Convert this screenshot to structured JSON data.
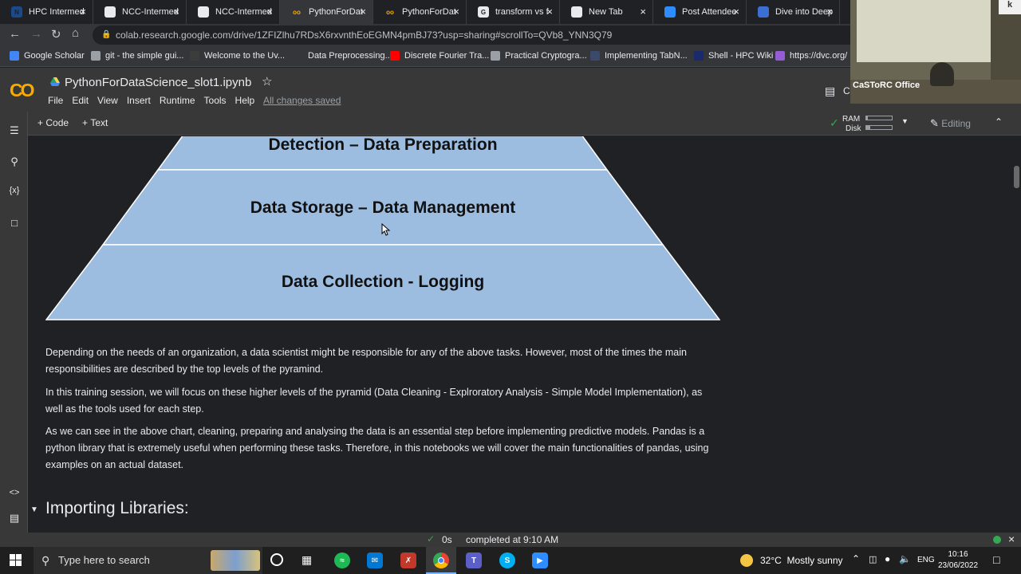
{
  "tabs": [
    {
      "title": "HPC Intermed",
      "color": "#1a4a8a",
      "glyph": "N"
    },
    {
      "title": "NCC-Intermed",
      "color": "#e8eaed",
      "glyph": ""
    },
    {
      "title": "NCC-Intermed",
      "color": "#e8eaed",
      "glyph": ""
    },
    {
      "title": "PythonForDat",
      "color": "#f9ab00",
      "glyph": "co",
      "active": true
    },
    {
      "title": "PythonForDat",
      "color": "#f9ab00",
      "glyph": "co"
    },
    {
      "title": "transform vs f",
      "color": "#e8eaed",
      "glyph": "G"
    },
    {
      "title": "New Tab",
      "color": "#e8eaed",
      "glyph": ""
    },
    {
      "title": "Post Attendee",
      "color": "#2d8cff",
      "glyph": ""
    },
    {
      "title": "Dive into Deep",
      "color": "#3b6fd4",
      "glyph": ""
    }
  ],
  "address": {
    "url": "colab.research.google.com/drive/1ZFIZlhu7RDsX6rxvnthEoEGMN4pmBJ73?usp=sharing#scrollTo=QVb8_YNN3Q79"
  },
  "bookmarks": [
    {
      "label": "Google Scholar",
      "color": "#4285f4"
    },
    {
      "label": "git - the simple gui...",
      "color": "#9aa0a6"
    },
    {
      "label": "Welcome to the Uv...",
      "color": "#3c3c3c"
    },
    {
      "label": "Data Preprocessing...",
      "color": "#35363a"
    },
    {
      "label": "Discrete Fourier Tra...",
      "color": "#ff0000"
    },
    {
      "label": "Practical Cryptogra...",
      "color": "#9aa0a6"
    },
    {
      "label": "Implementing TabN...",
      "color": "#3b4a6b"
    },
    {
      "label": "Shell - HPC Wiki",
      "color": "#1a2a6b"
    },
    {
      "label": "https://dvc.org/",
      "color": "#945dd6"
    }
  ],
  "colab": {
    "notebook_title": "PythonForDataScience_slot1.ipynb",
    "menus": [
      "File",
      "Edit",
      "View",
      "Insert",
      "Runtime",
      "Tools",
      "Help"
    ],
    "saved_status": "All changes saved",
    "comment_label": "C"
  },
  "toolbar": {
    "code_label": "Code",
    "text_label": "Text",
    "ram_label": "RAM",
    "disk_label": "Disk",
    "ram_level": 0.05,
    "disk_level": 0.15,
    "editing_label": "Editing"
  },
  "pyramid": {
    "levels": [
      "Detection – Data Preparation",
      "Data Storage – Data Management",
      "Data Collection - Logging"
    ],
    "fill": "#9dbde0"
  },
  "paragraphs": [
    "Depending on the needs of an organization, a data scientist might be responsible for any of the above tasks. However, most of the times the main responsibilities are described by the top levels of the pyramind.",
    "In this training session, we will focus on these higher levels of the pyramid (Data Cleaning - Explroratory Analysis - Simple Model Implementation), as well as the tools used for each step.",
    "As we can see in the above chart, cleaning, preparing and analysing the data is an essential step before implementing predictive models. Pandas is a python library that is extremely useful when performing these tasks. Therefore, in this notebooks we will cover the main functionalities of pandas, using examples on an actual dataset."
  ],
  "section_heading": "Importing Libraries:",
  "status": {
    "duration": "0s",
    "completed": "completed at 9:10 AM"
  },
  "webcam": {
    "label": "CaSToRC Office"
  },
  "taskbar": {
    "search_placeholder": "Type here to search",
    "weather": "32°C  Mostly sunny",
    "language": "ENG",
    "time": "10:16",
    "date": "23/06/2022"
  }
}
